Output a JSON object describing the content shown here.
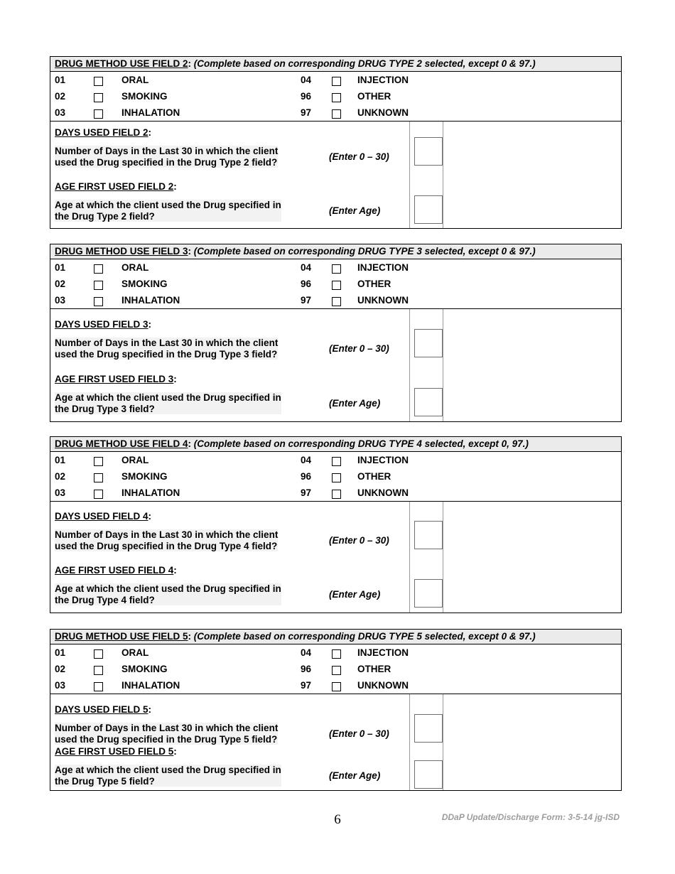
{
  "document": {
    "page_number": "6",
    "footer_note": "DDaP Update/Discharge Form:  3-5-14 jg-ISD"
  },
  "method_options": {
    "left": [
      {
        "code": "01",
        "label": "ORAL"
      },
      {
        "code": "02",
        "label": "SMOKING"
      },
      {
        "code": "03",
        "label": "INHALATION"
      }
    ],
    "right": [
      {
        "code": "04",
        "label": "INJECTION"
      },
      {
        "code": "96",
        "label": "OTHER"
      },
      {
        "code": "97",
        "label": "UNKNOWN"
      }
    ]
  },
  "sections": [
    {
      "id": "field2",
      "header_title": "DRUG METHOD USE FIELD 2",
      "header_colon": ":",
      "header_note": "(Complete based on corresponding DRUG TYPE 2 selected, except 0 & 97.)",
      "days": {
        "label_underlined": "DAYS USED FIELD 2",
        "label_colon": ":",
        "question_line1": "Number of Days in the Last 30 in which the client",
        "question_line2": "used the Drug specified in the Drug Type 2 field?",
        "hint": "(Enter 0 – 30)",
        "value": ""
      },
      "age": {
        "label_underlined": "AGE FIRST USED FIELD 2",
        "label_colon": ":",
        "question_line1": "Age at which the client used the Drug specified in",
        "question_line2": "the Drug Type 2 field?",
        "hint": "(Enter Age)",
        "value": ""
      }
    },
    {
      "id": "field3",
      "header_title": "DRUG METHOD USE FIELD 3",
      "header_colon": ":",
      "header_note": "(Complete based on corresponding DRUG TYPE 3 selected, except 0 & 97.)",
      "days": {
        "label_underlined": "DAYS USED FIELD 3",
        "label_colon": ":",
        "question_line1": "Number of Days in the Last 30 in which the client",
        "question_line2": "used the Drug specified in the Drug Type 3 field?",
        "hint": "(Enter 0 – 30)",
        "value": ""
      },
      "age": {
        "label_underlined": "AGE FIRST USED FIELD 3",
        "label_colon": ":",
        "question_line1": "Age at which the client used the Drug specified in",
        "question_line2": "the Drug Type 3 field?",
        "hint": "(Enter Age)",
        "value": ""
      }
    },
    {
      "id": "field4",
      "header_title": "DRUG METHOD USE FIELD 4",
      "header_colon": ":",
      "header_note": "(Complete based on corresponding DRUG TYPE 4 selected, except 0, 97.)",
      "days": {
        "label_underlined": "DAYS USED FIELD 4",
        "label_colon": ":",
        "question_line1": "Number of Days in the Last 30 in which the client",
        "question_line2": "used the Drug specified in the Drug Type 4 field?",
        "hint": "(Enter 0 – 30)",
        "value": ""
      },
      "age": {
        "label_underlined": "AGE FIRST USED FIELD 4",
        "label_colon": ":",
        "question_line1": "Age at which the client used the Drug specified in",
        "question_line2": "the Drug Type 4 field?",
        "hint": "(Enter Age)",
        "value": ""
      }
    },
    {
      "id": "field5",
      "header_title": "DRUG METHOD USE FIELD 5",
      "header_colon": ":",
      "header_note": "(Complete based on corresponding DRUG TYPE 5 selected, except 0 & 97.)",
      "days": {
        "label_underlined": "DAYS USED FIELD 5",
        "label_colon": ":",
        "question_line1": "Number of Days in the Last 30 in which the client",
        "question_line2": "used the Drug specified in the Drug Type 5 field?",
        "hint": "(Enter 0 – 30)",
        "value": ""
      },
      "age": {
        "label_underlined": "AGE FIRST USED FIELD 5",
        "label_colon": ":",
        "question_line1": "Age at which the client used the Drug specified in",
        "question_line2": "the Drug Type 5 field?",
        "hint": "(Enter Age)",
        "value": ""
      }
    }
  ]
}
